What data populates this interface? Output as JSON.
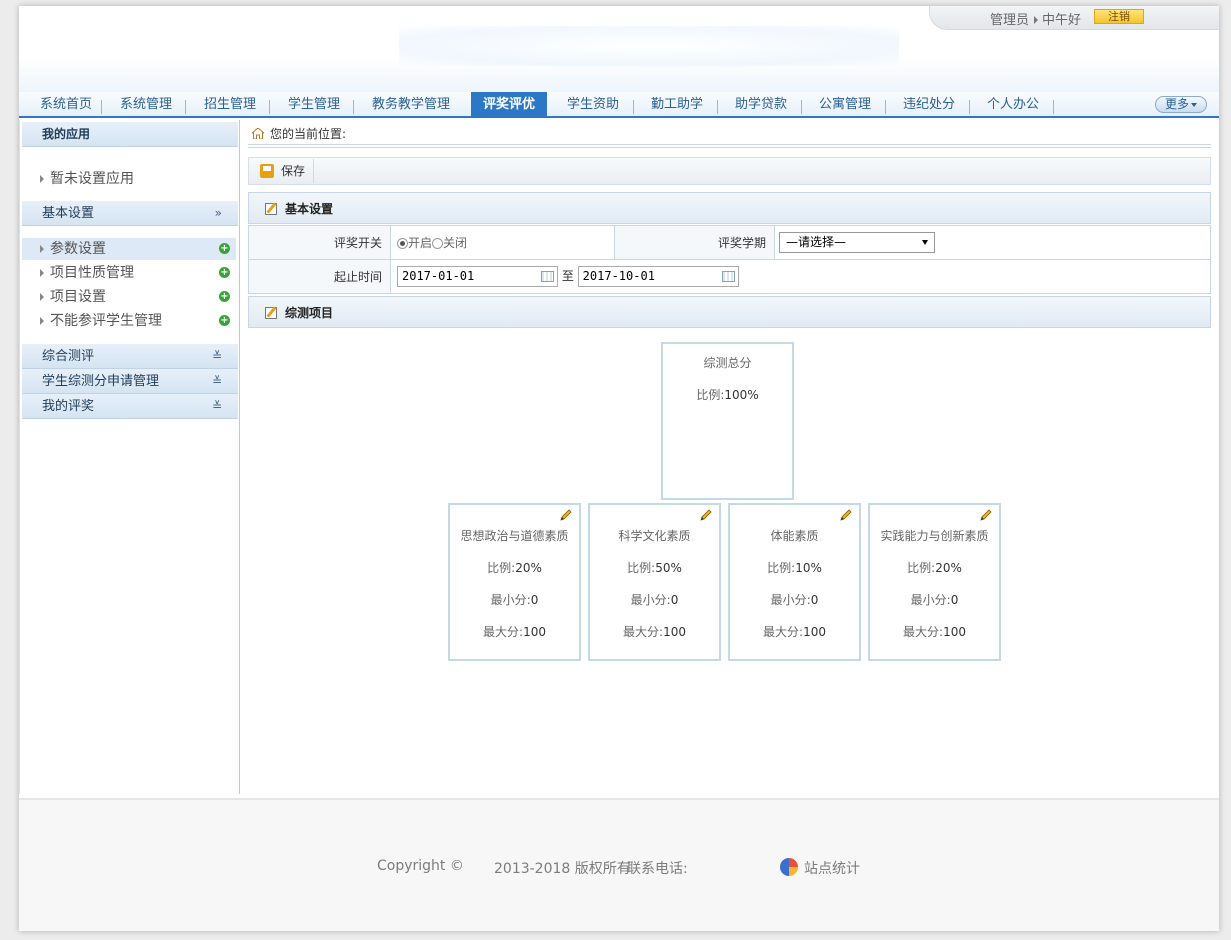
{
  "header": {
    "user": "管理员",
    "greeting": "中午好",
    "logout_label": "注销"
  },
  "nav": {
    "items": [
      {
        "label": "系统首页"
      },
      {
        "label": "系统管理"
      },
      {
        "label": "招生管理"
      },
      {
        "label": "学生管理"
      },
      {
        "label": "教务教学管理"
      },
      {
        "label": "评奖评优",
        "active": true
      },
      {
        "label": "学生资助"
      },
      {
        "label": "勤工助学"
      },
      {
        "label": "助学贷款"
      },
      {
        "label": "公寓管理"
      },
      {
        "label": "违纪处分"
      },
      {
        "label": "个人办公"
      }
    ],
    "more_label": "更多"
  },
  "sidebar": {
    "my_apps_title": "我的应用",
    "no_app_text": "暂未设置应用",
    "basic_settings_title": "基本设置",
    "basic_settings_chev": "»",
    "items": [
      {
        "label": "参数设置",
        "selected": true
      },
      {
        "label": "项目性质管理"
      },
      {
        "label": "项目设置"
      },
      {
        "label": "不能参评学生管理"
      }
    ],
    "sections": [
      {
        "label": "综合测评",
        "chev": "≚"
      },
      {
        "label": "学生综测分申请管理",
        "chev": "≚"
      },
      {
        "label": "我的评奖",
        "chev": "≚"
      }
    ]
  },
  "main": {
    "breadcrumb": "您的当前位置:",
    "save_label": "保存",
    "basic_section_title": "基本设置",
    "form": {
      "switch_label": "评奖开关",
      "switch_on": "开启",
      "switch_off": "关闭",
      "switch_value": "开启",
      "term_label": "评奖学期",
      "term_value": "—请选择—",
      "period_label": "起止时间",
      "start_date": "2017-01-01",
      "to_label": "至",
      "end_date": "2017-10-01"
    },
    "items_section_title": "综测项目"
  },
  "tree": {
    "root": {
      "title": "综测总分",
      "ratio_label": "比例:",
      "ratio": "100%"
    },
    "min_label": "最小分:",
    "max_label": "最大分:",
    "ratio_label": "比例:",
    "children": [
      {
        "title": "思想政治与道德素质",
        "ratio": "20%",
        "min": "0",
        "max": "100"
      },
      {
        "title": "科学文化素质",
        "ratio": "50%",
        "min": "0",
        "max": "100"
      },
      {
        "title": "体能素质",
        "ratio": "10%",
        "min": "0",
        "max": "100"
      },
      {
        "title": "实践能力与创新素质",
        "ratio": "20%",
        "min": "0",
        "max": "100"
      }
    ]
  },
  "footer": {
    "copyright": "Copyright ©",
    "rights": "2013-2018 版权所有",
    "contact_label": "联系电话:",
    "stats_label": "站点统计"
  }
}
